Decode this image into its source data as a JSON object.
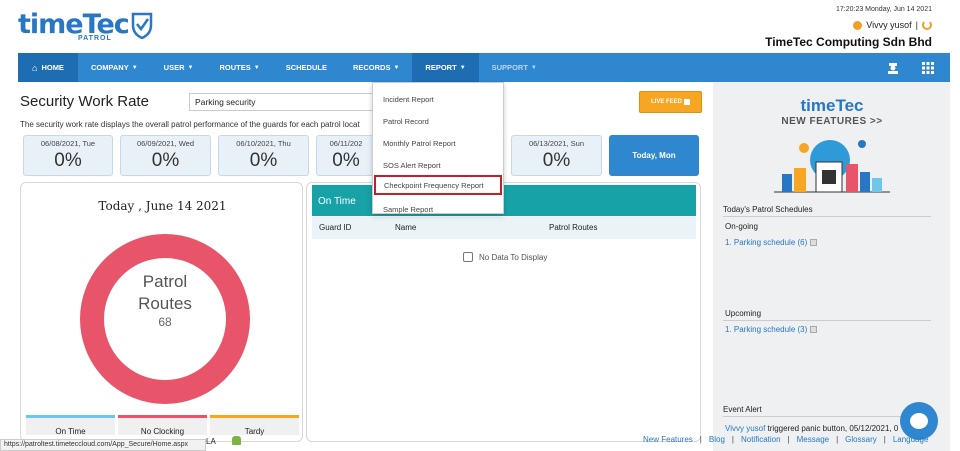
{
  "header": {
    "logo_text": "timeTec",
    "logo_sub": "PATROL",
    "datetime": "17:20:23 Monday, Jun 14 2021",
    "user_name": "Vivvy yusof",
    "user_sep": "|",
    "company": "TimeTec Computing Sdn Bhd"
  },
  "nav": {
    "items": [
      {
        "label": "HOME",
        "icon": "home-icon"
      },
      {
        "label": "COMPANY",
        "caret": true
      },
      {
        "label": "USER",
        "caret": true
      },
      {
        "label": "ROUTES",
        "caret": true
      },
      {
        "label": "SCHEDULE"
      },
      {
        "label": "RECORDS",
        "caret": true
      },
      {
        "label": "REPORT",
        "caret": true,
        "active": true
      },
      {
        "label": "SUPPORT",
        "caret": true
      }
    ],
    "caret_glyph": "▼",
    "home_glyph": "⌂",
    "right_icons": [
      "guard-icon",
      "grid-icon"
    ]
  },
  "page": {
    "title": "Security Work Rate",
    "site_selected": "Parking security",
    "live_feed": "LIVE FEED",
    "description": "The security work rate displays the overall patrol performance of the guards for each patrol locat"
  },
  "days": [
    {
      "date": "06/08/2021, Tue",
      "pct": "0%"
    },
    {
      "date": "06/09/2021, Wed",
      "pct": "0%"
    },
    {
      "date": "06/10/2021, Thu",
      "pct": "0%"
    },
    {
      "date": "06/11/202",
      "pct": "0%"
    },
    {
      "date": "06/13/2021, Sun",
      "pct": "0%"
    }
  ],
  "today_label": "Today, Mon",
  "donut": {
    "title": "Today , June 14 2021",
    "label_line1": "Patrol",
    "label_line2": "Routes",
    "count": "68",
    "ring_color": "#e8546a",
    "legend": [
      "On Time",
      "No Clocking",
      "Tardy"
    ]
  },
  "table": {
    "header": "On Time",
    "columns": [
      "Guard ID",
      "Name",
      "Patrol Routes"
    ],
    "empty": "No Data To Display",
    "header_color": "#17a2a8"
  },
  "dropdown": {
    "items": [
      "Incident Report",
      "Patrol Record",
      "Monthly Patrol Report",
      "SOS Alert Report",
      "Checkpoint Frequency Report",
      "Sample Report"
    ],
    "highlighted": "Checkpoint Frequency Report"
  },
  "sidebar": {
    "promo_brand": "timeTec",
    "promo_line": "NEW FEATURES >>",
    "patrol_schedules_title": "Today's Patrol Schedules",
    "ongoing_label": "On-going",
    "ongoing_item": "1. Parking schedule (6)",
    "upcoming_label": "Upcoming",
    "upcoming_item": "1. Parking schedule (3)",
    "event_alert_title": "Event Alert",
    "event_user": "Vivvy yusof",
    "event_text": " triggered panic button, 05/12/2021, 0"
  },
  "footer": {
    "links": [
      "New Features",
      "Blog",
      "Notification",
      "Message",
      "Glossary",
      "Language"
    ],
    "sep": "|",
    "status_url": "https://patroltest.timeteccloud.com/App_Secure/Home.aspx",
    "frag": "LA"
  },
  "colors": {
    "nav_blue": "#2f87d0",
    "nav_active": "#1e6db3",
    "accent_orange": "#f6a623",
    "teal": "#17a2a8",
    "highlight_red": "#c0202a"
  }
}
